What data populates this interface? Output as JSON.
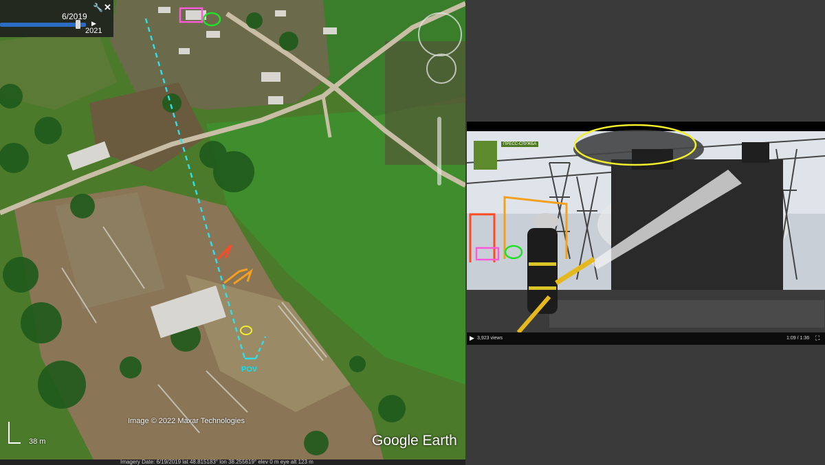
{
  "earth": {
    "history": {
      "date_label": "6/2019",
      "year_label": "2021",
      "slider_fraction": 0.9,
      "tool_icon": "wrench-icon",
      "close_icon": "close-icon",
      "play_icon": "play-icon"
    },
    "attribution": "Image © 2022 Maxar Technologies",
    "logo": "Google Earth",
    "scale": "38 m",
    "status": "Imagery Date: 6/19/2019   lat  48.815183°   lon  38.255619°   elev   0 m   eye alt  123 m",
    "pov_label": "POV",
    "colors": {
      "sightline": "#33dde6",
      "marker_magenta": "#ff5ad9",
      "marker_green": "#22e02a",
      "marker_yellow": "#f2ef2a",
      "arrow_red": "#ff4a23",
      "arrow_orange": "#f3a01f"
    }
  },
  "video": {
    "press_badge_line1": "ПРЕСС-СЛУЖБА",
    "press_badge_line2": "НАРОДНОЙ МИЛИЦИИ",
    "press_badge_line3": "ЛУГАНСКОЙ НАРОДНОЙ РЕСПУБЛИКИ",
    "views": "3,923 views",
    "time": "1:09 / 1:36",
    "play_icon": "play-icon",
    "fullscreen_icon": "fullscreen-icon"
  }
}
